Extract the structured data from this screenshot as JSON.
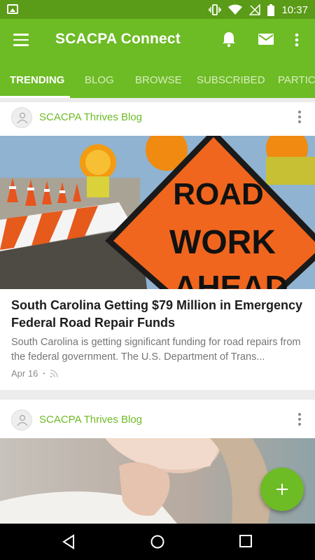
{
  "status_bar": {
    "time": "10:37",
    "icons": [
      "image-icon",
      "vibrate-icon",
      "wifi-icon",
      "no-signal-icon",
      "battery-icon"
    ]
  },
  "app_bar": {
    "title": "SCACPA Connect",
    "icons": [
      "menu-icon",
      "bell-icon",
      "mail-icon",
      "more-vert-icon"
    ]
  },
  "tabs": [
    {
      "label": "TRENDING",
      "active": true
    },
    {
      "label": "BLOG",
      "active": false
    },
    {
      "label": "BROWSE",
      "active": false
    },
    {
      "label": "SUBSCRIBED",
      "active": false
    },
    {
      "label": "PARTIC",
      "active": false
    }
  ],
  "posts": [
    {
      "source": "SCACPA Thrives Blog",
      "image": "road-work-ahead-sign",
      "headline": "South Carolina Getting $79 Million in Emergency Federal Road Repair Funds",
      "excerpt": "South Carolina is getting significant funding for road repairs from the federal government. The U.S. Department of Trans...",
      "date": "Apr 16",
      "separator": "•"
    },
    {
      "source": "SCACPA Thrives Blog",
      "image": "woman-on-phone-photo"
    }
  ],
  "sign_text": [
    "ROAD",
    "WORK",
    "AHEAD"
  ],
  "colors": {
    "status_bar": "#5a9b17",
    "app_bar": "#6dbb25",
    "accent": "#6dbb25",
    "fab": "#6dbb25"
  },
  "nav_bar": [
    "back-icon",
    "home-icon",
    "recents-icon"
  ]
}
